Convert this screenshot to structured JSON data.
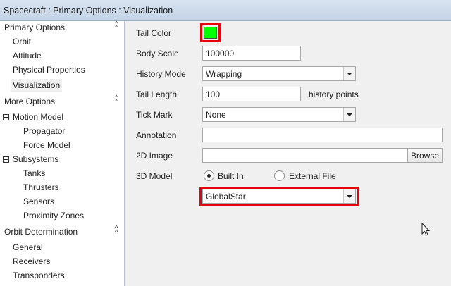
{
  "window": {
    "title": "Spacecraft : Primary Options : Visualization"
  },
  "sidebar": {
    "sections": [
      {
        "label": "Primary Options",
        "toggle_icon": "collapse-up-icon",
        "items": [
          "Orbit",
          "Attitude",
          "Physical Properties",
          "Visualization"
        ],
        "selected": "Visualization"
      },
      {
        "label": "More Options",
        "toggle_icon": "collapse-up-icon",
        "groups": [
          {
            "label": "Motion Model",
            "expanded": true,
            "items": [
              "Propagator",
              "Force Model"
            ]
          },
          {
            "label": "Subsystems",
            "expanded": true,
            "items": [
              "Tanks",
              "Thrusters",
              "Sensors",
              "Proximity Zones"
            ]
          }
        ]
      },
      {
        "label": "Orbit Determination",
        "toggle_icon": "collapse-up-icon",
        "items": [
          "General",
          "Receivers",
          "Transponders"
        ]
      }
    ]
  },
  "form": {
    "tail_color": {
      "label": "Tail Color",
      "color": "#00ff00"
    },
    "body_scale": {
      "label": "Body Scale",
      "value": "100000"
    },
    "history_mode": {
      "label": "History Mode",
      "value": "Wrapping"
    },
    "tail_length": {
      "label": "Tail Length",
      "value": "100",
      "suffix": "history points"
    },
    "tick_mark": {
      "label": "Tick Mark",
      "value": "None"
    },
    "annotation": {
      "label": "Annotation",
      "value": ""
    },
    "image_2d": {
      "label": "2D Image",
      "value": "",
      "browse_label": "Browse"
    },
    "model_3d": {
      "label": "3D Model",
      "options": [
        "Built In",
        "External File"
      ],
      "selected": "Built In",
      "model_value": "GlobalStar"
    }
  },
  "colors": {
    "highlight": "#e8000b",
    "accent_titlebar": "#c3d3e6"
  }
}
